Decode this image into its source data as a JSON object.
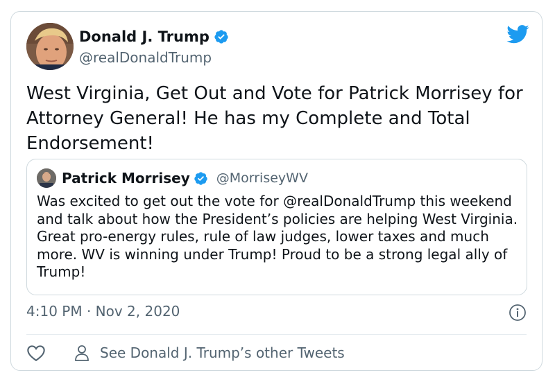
{
  "tweet": {
    "author": {
      "name": "Donald J. Trump",
      "handle": "@realDonaldTrump",
      "verified": true
    },
    "text": "West Virginia, Get Out and Vote for Patrick Morrisey for Attorney General! He has my Complete and Total Endorsement!",
    "timestamp": "4:10 PM · Nov 2, 2020"
  },
  "quoted_tweet": {
    "author": {
      "name": "Patrick Morrisey",
      "handle": "@MorriseyWV",
      "verified": true
    },
    "text": "Was excited to get out the vote for @realDonaldTrump this weekend and talk about how the President’s policies are helping West Virginia.  Great pro-energy rules, rule of law judges, lower taxes and much more.  WV is winning under Trump! Proud to be a strong legal ally of Trump!"
  },
  "actions": {
    "see_more_label": "See Donald J. Trump’s other Tweets"
  },
  "icons": {
    "brand": "twitter-bird-icon",
    "verified": "verified-badge-icon",
    "info": "info-icon",
    "like": "heart-icon",
    "profile": "person-icon"
  },
  "colors": {
    "brand": "#1d9bf0",
    "text_primary": "#0f1419",
    "text_secondary": "#536471",
    "border": "#cfd9de"
  }
}
